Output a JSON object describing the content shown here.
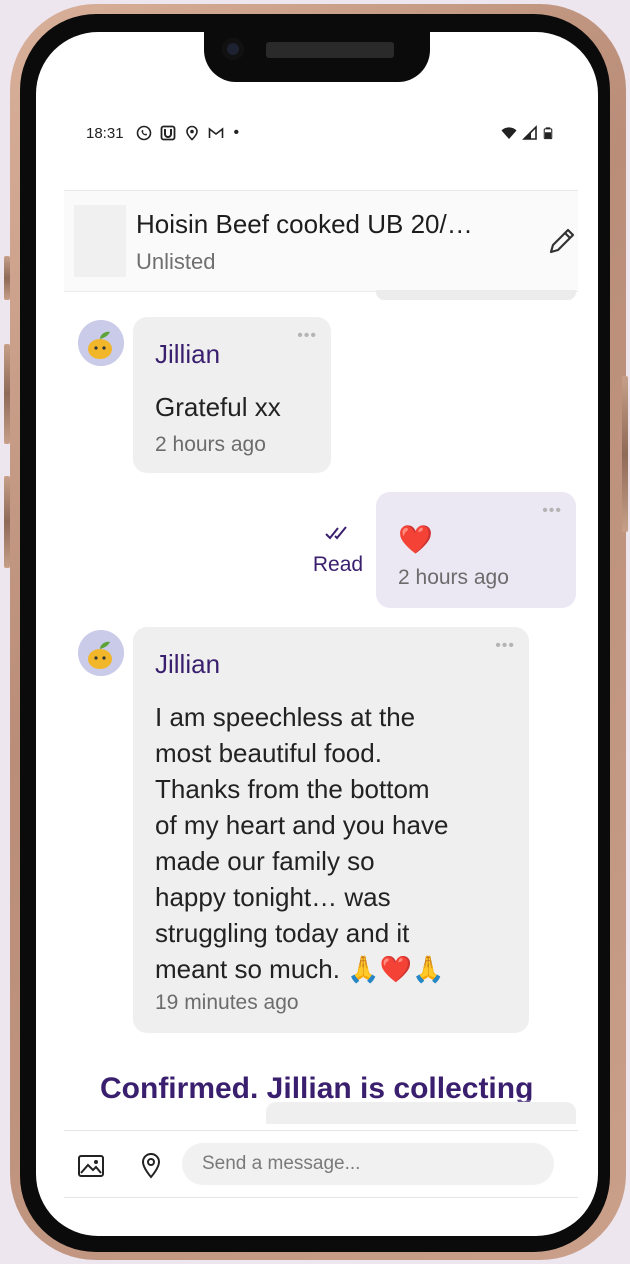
{
  "status_bar": {
    "time": "18:31"
  },
  "listing": {
    "title": "Hoisin Beef cooked UB 20/…",
    "status": "Unlisted"
  },
  "messages": [
    {
      "sender": "Jillian",
      "text": "Grateful xx",
      "time": "2 hours ago",
      "mine": false
    },
    {
      "sender": "",
      "text": "❤️",
      "time": "2 hours ago",
      "mine": true,
      "receipt": "Read"
    },
    {
      "sender": "Jillian",
      "lines": [
        "I am speechless at the",
        "most beautiful food.",
        "Thanks from the bottom",
        "of my heart and you have",
        "made our family so",
        "happy tonight… was",
        "struggling today and it",
        "meant so much. 🙏❤️🙏"
      ],
      "time": "19 minutes ago",
      "mine": false
    }
  ],
  "system_message": "Confirmed. Jillian is collecting",
  "composer": {
    "placeholder": "Send a message..."
  },
  "colors": {
    "accent": "#3a1f6e",
    "bubble_other": "#efefef",
    "bubble_mine": "#ebe8f3"
  },
  "icons": [
    "whatsapp-icon",
    "u-icon",
    "location-pin-icon",
    "gmail-icon",
    "wifi-icon",
    "signal-icon",
    "battery-icon",
    "edit-pencil-icon",
    "double-check-icon",
    "more-dots-icon",
    "image-icon",
    "location-icon"
  ]
}
